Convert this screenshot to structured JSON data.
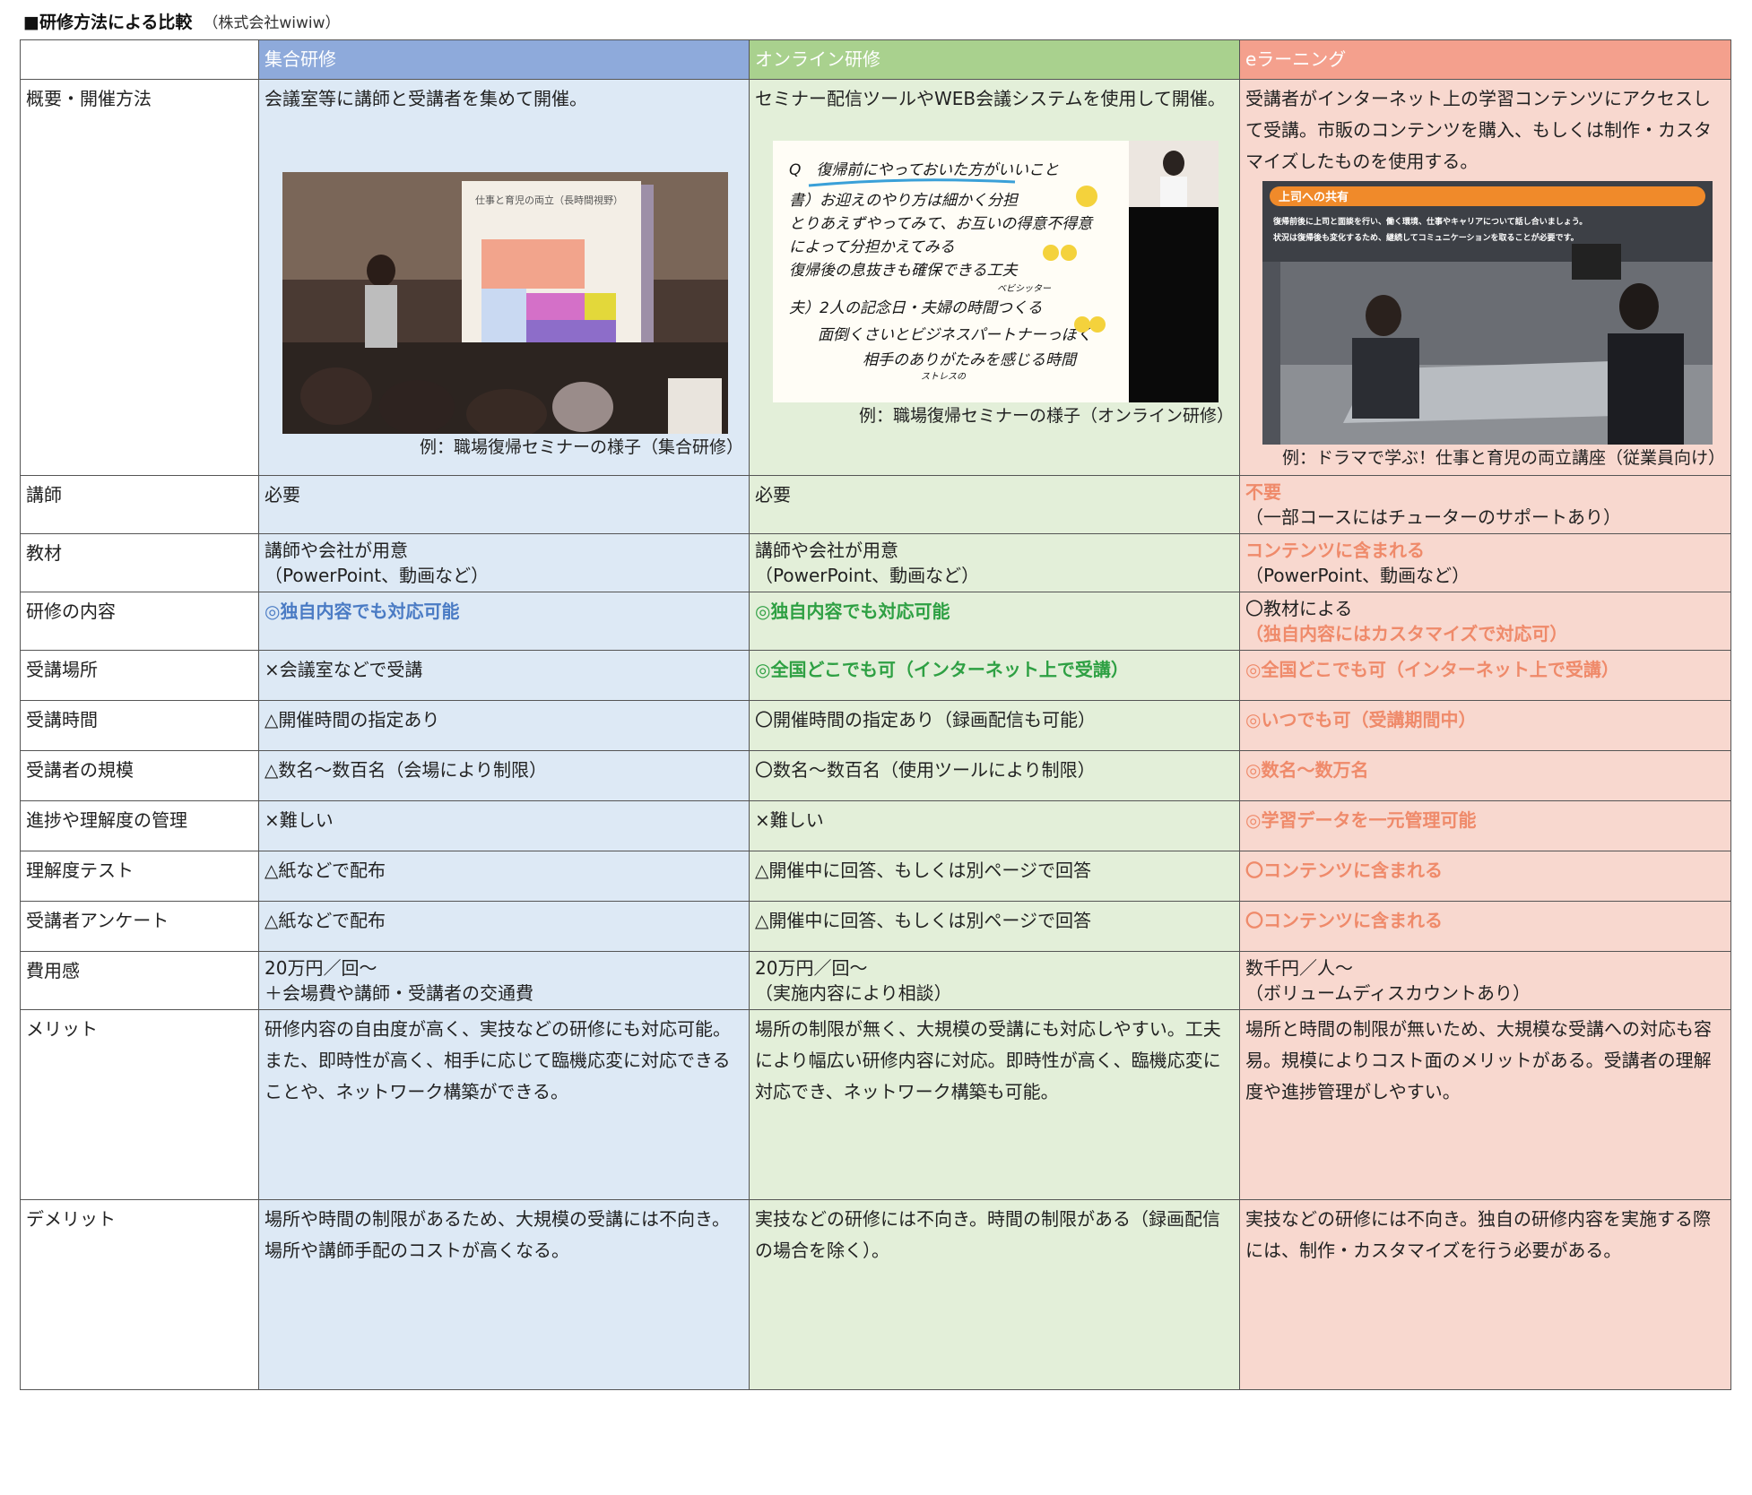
{
  "title": "■研修方法による比較",
  "company": "（株式会社wiwiw）",
  "columns": [
    "集合研修",
    "オンライン研修",
    "eラーニング"
  ],
  "overview": {
    "label": "概要・開催方法",
    "c1": "会議室等に講師と受講者を集めて開催。",
    "c2": "セミナー配信ツールやWEB会議システムを使用して開催。",
    "c3": "受講者がインターネット上の学習コンテンツにアクセスして受講。市販のコンテンツを購入、もしくは制作・カスタマイズしたものを使用する。",
    "cap1": "例：職場復帰セミナーの様子（集合研修）",
    "cap2": "例：職場復帰セミナーの様子（オンライン研修）",
    "cap3": "例：ドラマで学ぶ！仕事と育児の両立講座（従業員向け）",
    "img1": {
      "slide_title": "仕事と育児の両立（長時間視野）"
    },
    "img2": {
      "lines": [
        "Q　復帰前にやっておいた方がいいこと",
        "書）お迎えのやり方は細かく分担",
        "とりあえずやってみて、お互いの得意不得意",
        "によって分担かえてみる",
        "復帰後の息抜きも確保できる工夫",
        "ベビシッター",
        "夫）2人の記念日・夫婦の時間つくる",
        "面倒くさいとビジネスパートナーっぽく",
        "相手のありがたみを感じる時間",
        "ストレスの"
      ]
    },
    "img3": {
      "banner": "上司への共有",
      "line1": "復帰前後に上司と面談を行い、働く環境、仕事やキャリアについて話し合いましょう。",
      "line2": "状況は復帰後も変化するため、継続してコミュニケーションを取ることが必要です。"
    }
  },
  "rows": [
    {
      "label": "講師",
      "c1": "必要",
      "c2": "必要",
      "c3a": "不要",
      "c3b": "（一部コースにはチューターのサポートあり）"
    },
    {
      "label": "教材",
      "c1a": "講師や会社が用意",
      "c1b": "（PowerPoint、動画など）",
      "c2a": "講師や会社が用意",
      "c2b": "（PowerPoint、動画など）",
      "c3a": "コンテンツに含まれる",
      "c3b": "（PowerPoint、動画など）"
    },
    {
      "label": "研修の内容",
      "c1": "◎独自内容でも対応可能",
      "c2": "◎独自内容でも対応可能",
      "c3a": "〇教材による",
      "c3b": "（独自内容にはカスタマイズで対応可）"
    },
    {
      "label": "受講場所",
      "c1": "×会議室などで受講",
      "c2": "◎全国どこでも可（インターネット上で受講）",
      "c3": "◎全国どこでも可（インターネット上で受講）"
    },
    {
      "label": "受講時間",
      "c1": "△開催時間の指定あり",
      "c2": "〇開催時間の指定あり（録画配信も可能）",
      "c3": "◎いつでも可（受講期間中）"
    },
    {
      "label": "受講者の規模",
      "c1": "△数名～数百名（会場により制限）",
      "c2": "〇数名～数百名（使用ツールにより制限）",
      "c3": "◎数名～数万名"
    },
    {
      "label": "進捗や理解度の管理",
      "c1": "×難しい",
      "c2": "×難しい",
      "c3": "◎学習データを一元管理可能"
    },
    {
      "label": "理解度テスト",
      "c1": "△紙などで配布",
      "c2": "△開催中に回答、もしくは別ページで回答",
      "c3": "〇コンテンツに含まれる"
    },
    {
      "label": "受講者アンケート",
      "c1": "△紙などで配布",
      "c2": "△開催中に回答、もしくは別ページで回答",
      "c3": "〇コンテンツに含まれる"
    },
    {
      "label": "費用感",
      "c1a": "20万円／回～",
      "c1b": "＋会場費や講師・受講者の交通費",
      "c2a": "20万円／回～",
      "c2b": "（実施内容により相談）",
      "c3a": "数千円／人～",
      "c3b": "（ボリュームディスカウントあり）"
    },
    {
      "label": "メリット",
      "c1": "研修内容の自由度が高く、実技などの研修にも対応可能。また、即時性が高く、相手に応じて臨機応変に対応できることや、ネットワーク構築ができる。",
      "c2": "場所の制限が無く、大規模の受講にも対応しやすい。工夫により幅広い研修内容に対応。即時性が高く、臨機応変に対応でき、ネットワーク構築も可能。",
      "c3": "場所と時間の制限が無いため、大規模な受講への対応も容易。規模によりコスト面のメリットがある。受講者の理解度や進捗管理がしやすい。"
    },
    {
      "label": "デメリット",
      "c1": "場所や時間の制限があるため、大規模の受講には不向き。場所や講師手配のコストが高くなる。",
      "c2": "実技などの研修には不向き。時間の制限がある（録画配信の場合を除く）。",
      "c3": "実技などの研修には不向き。独自の研修内容を実施する際には、制作・カスタマイズを行う必要がある。"
    }
  ]
}
